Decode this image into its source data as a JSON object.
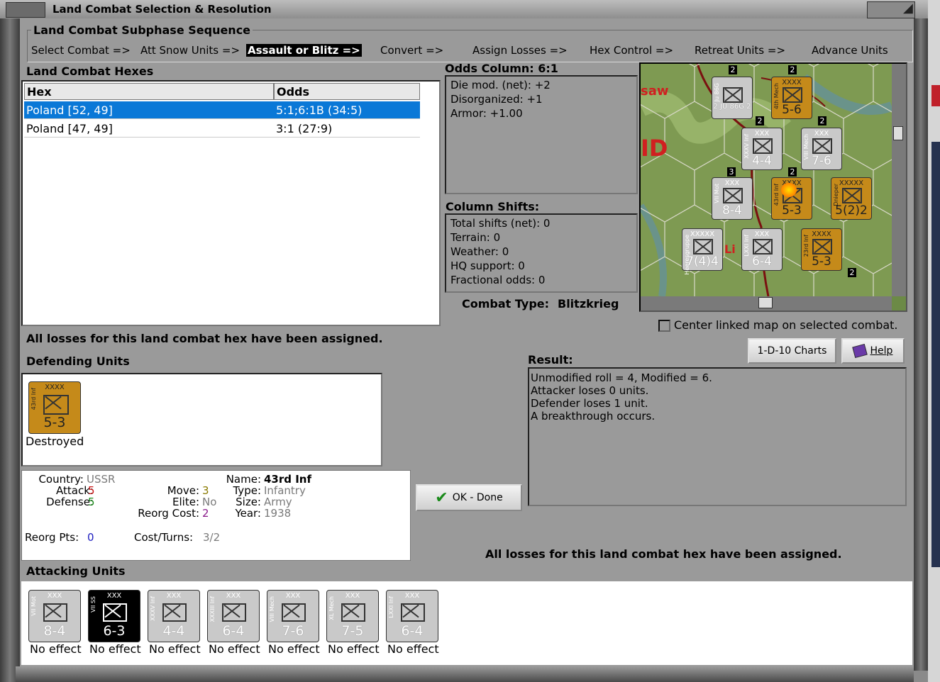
{
  "window": {
    "title": "Land Combat Selection & Resolution"
  },
  "subphase": {
    "title": "Land Combat Subphase Sequence",
    "steps": [
      "Select Combat =>",
      "Att Snow Units =>",
      "Assault or Blitz =>",
      "Convert =>",
      "Assign Losses =>",
      "Hex Control =>",
      "Retreat Units =>",
      "Advance Units"
    ],
    "active": "Assault or Blitz =>"
  },
  "hexes": {
    "title": "Land Combat Hexes",
    "columns": [
      "Hex",
      "Odds"
    ],
    "rows": [
      {
        "hex": "Poland [52, 49]",
        "odds": "5:1;6:1B (34:5)"
      },
      {
        "hex": "Poland [47, 49]",
        "odds": "3:1 (27:9)"
      }
    ]
  },
  "odds": {
    "title": "Odds Column: 6:1",
    "lines": [
      "Die mod. (net): +2",
      "Disorganized: +1",
      "Armor: +1.00"
    ]
  },
  "shifts": {
    "title": "Column Shifts:",
    "lines": [
      "Total shifts (net): 0",
      "Terrain: 0",
      "Weather: 0",
      "HQ support: 0",
      "Fractional odds: 0"
    ]
  },
  "combat_type": {
    "label": "Combat Type:",
    "value": "Blitzkrieg"
  },
  "center_map": {
    "label": "Center linked map on selected combat.",
    "checked": false
  },
  "losses_msg": "All losses for this land combat hex have been assigned.",
  "buttons": {
    "charts": "1-D-10 Charts",
    "help": "Help",
    "ok": "OK - Done"
  },
  "result": {
    "title": "Result:",
    "lines": [
      "Unmodified roll = 4, Modified = 6.",
      "Attacker loses 0 units.",
      "Defender loses 1 unit.",
      "A breakthrough occurs."
    ]
  },
  "defending": {
    "title": "Defending Units",
    "units": [
      {
        "name": "43rd Inf",
        "size": "XXXX",
        "strength": "5-3",
        "status": "Destroyed",
        "color": "#c58a1a"
      }
    ]
  },
  "unit_info": {
    "country_label": "Country:",
    "country": "USSR",
    "attack_label": "Attack:",
    "attack": "5",
    "defense_label": "Defense:",
    "defense": "5",
    "move_label": "Move:",
    "move": "3",
    "elite_label": "Elite:",
    "elite": "No",
    "reorg_cost_label": "Reorg Cost:",
    "reorg_cost": "2",
    "name_label": "Name:",
    "name": "43rd Inf",
    "type_label": "Type:",
    "type": "Infantry",
    "size_label": "Size:",
    "size": "Army",
    "year_label": "Year:",
    "year": "1938",
    "reorg_pts_label": "Reorg Pts:",
    "reorg_pts": "0",
    "cost_turns_label": "Cost/Turns:",
    "cost_turns": "3/2"
  },
  "attacking": {
    "title": "Attacking Units",
    "units": [
      {
        "name": "VII Mot",
        "size": "XXX",
        "strength": "8-4",
        "status": "No effect",
        "style": "gray"
      },
      {
        "name": "VII SS",
        "size": "XXX",
        "strength": "6-3",
        "status": "No effect",
        "style": "black"
      },
      {
        "name": "XXXV Inf",
        "size": "XXX",
        "strength": "4-4",
        "status": "No effect",
        "style": "gray"
      },
      {
        "name": "XXXIII Inf",
        "size": "XXX",
        "strength": "6-4",
        "status": "No effect",
        "style": "gray"
      },
      {
        "name": "VIII Mech",
        "size": "XXX",
        "strength": "7-6",
        "status": "No effect",
        "style": "gray"
      },
      {
        "name": "XL Mech",
        "size": "XXX",
        "strength": "7-5",
        "status": "No effect",
        "style": "gray"
      },
      {
        "name": "LXXI Inf",
        "size": "XXX",
        "strength": "6-4",
        "status": "No effect",
        "style": "gray"
      }
    ]
  },
  "map": {
    "labels": [
      "saw",
      "ID",
      "Li"
    ],
    "counters": [
      {
        "name": "Ju 86G",
        "strength": "2 JU 86G 2",
        "style": "gray"
      },
      {
        "name": "4th Mech",
        "size": "XXXX",
        "strength": "5-6",
        "style": "orange"
      },
      {
        "name": "XXXV Inf",
        "size": "XXX",
        "strength": "4-4",
        "style": "gray"
      },
      {
        "name": "VIII Mech",
        "size": "XXX",
        "strength": "7-6",
        "style": "gray"
      },
      {
        "name": "VII Mot",
        "size": "XXX",
        "strength": "8-4",
        "style": "gray"
      },
      {
        "name": "43rd Inf",
        "size": "XXXX",
        "strength": "5-3",
        "style": "orange"
      },
      {
        "name": "Dnieper",
        "size": "XXXXX",
        "strength": "5(2)2",
        "style": "orange"
      },
      {
        "name": "Heeresgruppe",
        "size": "XXXXX",
        "strength": "7(4)4",
        "style": "gray"
      },
      {
        "name": "LXXI Inf",
        "size": "XXX",
        "strength": "6-4",
        "style": "gray"
      },
      {
        "name": "23rd Inf",
        "size": "XXXX",
        "strength": "5-3",
        "style": "orange"
      }
    ],
    "stack_numbers": [
      "2",
      "2",
      "2",
      "2",
      "3",
      "2",
      "2"
    ]
  }
}
